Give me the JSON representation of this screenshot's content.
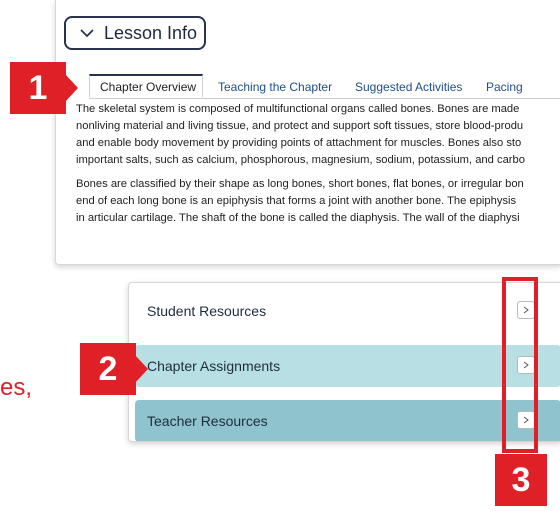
{
  "lesson_button": {
    "label": "Lesson Info"
  },
  "tabs": [
    {
      "label": "Chapter Overview"
    },
    {
      "label": "Teaching the Chapter"
    },
    {
      "label": "Suggested Activities"
    },
    {
      "label": "Pacing"
    }
  ],
  "content": {
    "paragraph1": [
      "The skeletal system is composed of multifunctional organs called bones. Bones are made",
      "nonliving material and living tissue, and protect and support soft tissues, store blood-produ",
      "and enable body movement by providing points of attachment for muscles. Bones also sto",
      "important salts, such as calcium, phosphorous, magnesium, sodium, potassium, and carbo"
    ],
    "paragraph2": [
      "Bones are classified by their shape as long bones, short bones, flat bones, or irregular bon",
      "end of each long bone is an epiphysis that forms a joint with another bone. The epiphysis",
      "in articular cartilage. The shaft of the bone is called the diaphysis. The wall of the diaphysi"
    ]
  },
  "resources": [
    {
      "label": "Student Resources",
      "bg": "#ffffff"
    },
    {
      "label": "Chapter Assignments",
      "bg": "#b8e0e4"
    },
    {
      "label": "Teacher Resources",
      "bg": "#8fc3cd"
    }
  ],
  "markers": {
    "m1": "1",
    "m2": "2",
    "m3": "3"
  },
  "side_text": "es,",
  "colors": {
    "accent": "#e02027",
    "navy": "#2a3250"
  }
}
